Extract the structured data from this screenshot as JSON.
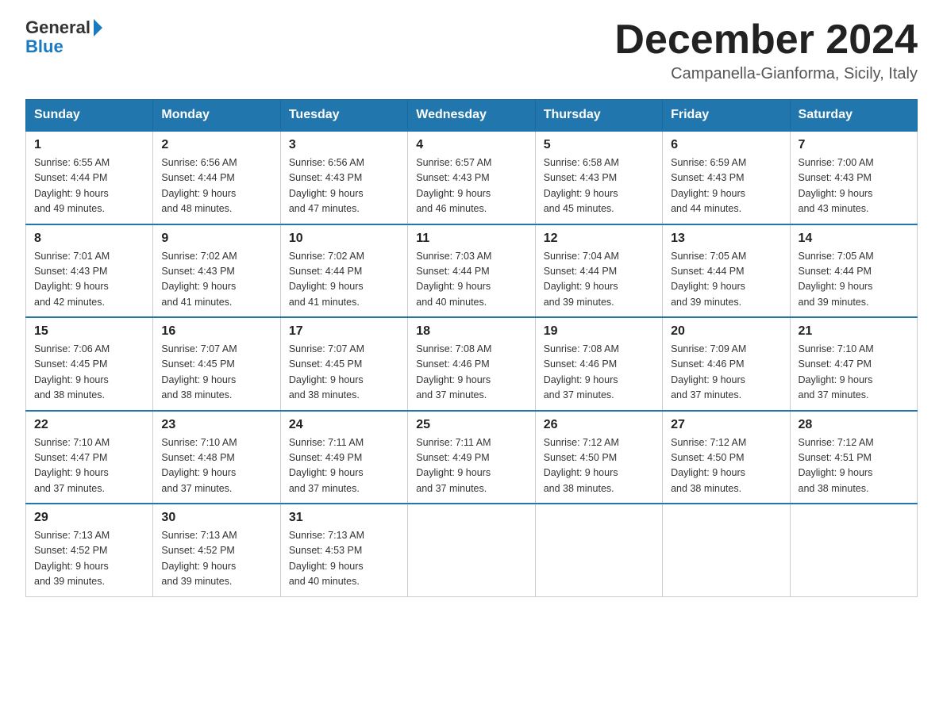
{
  "header": {
    "logo_general": "General",
    "logo_blue": "Blue",
    "month_title": "December 2024",
    "location": "Campanella-Gianforma, Sicily, Italy"
  },
  "days_of_week": [
    "Sunday",
    "Monday",
    "Tuesday",
    "Wednesday",
    "Thursday",
    "Friday",
    "Saturday"
  ],
  "weeks": [
    [
      {
        "day": "1",
        "sunrise": "6:55 AM",
        "sunset": "4:44 PM",
        "daylight": "9 hours and 49 minutes."
      },
      {
        "day": "2",
        "sunrise": "6:56 AM",
        "sunset": "4:44 PM",
        "daylight": "9 hours and 48 minutes."
      },
      {
        "day": "3",
        "sunrise": "6:56 AM",
        "sunset": "4:43 PM",
        "daylight": "9 hours and 47 minutes."
      },
      {
        "day": "4",
        "sunrise": "6:57 AM",
        "sunset": "4:43 PM",
        "daylight": "9 hours and 46 minutes."
      },
      {
        "day": "5",
        "sunrise": "6:58 AM",
        "sunset": "4:43 PM",
        "daylight": "9 hours and 45 minutes."
      },
      {
        "day": "6",
        "sunrise": "6:59 AM",
        "sunset": "4:43 PM",
        "daylight": "9 hours and 44 minutes."
      },
      {
        "day": "7",
        "sunrise": "7:00 AM",
        "sunset": "4:43 PM",
        "daylight": "9 hours and 43 minutes."
      }
    ],
    [
      {
        "day": "8",
        "sunrise": "7:01 AM",
        "sunset": "4:43 PM",
        "daylight": "9 hours and 42 minutes."
      },
      {
        "day": "9",
        "sunrise": "7:02 AM",
        "sunset": "4:43 PM",
        "daylight": "9 hours and 41 minutes."
      },
      {
        "day": "10",
        "sunrise": "7:02 AM",
        "sunset": "4:44 PM",
        "daylight": "9 hours and 41 minutes."
      },
      {
        "day": "11",
        "sunrise": "7:03 AM",
        "sunset": "4:44 PM",
        "daylight": "9 hours and 40 minutes."
      },
      {
        "day": "12",
        "sunrise": "7:04 AM",
        "sunset": "4:44 PM",
        "daylight": "9 hours and 39 minutes."
      },
      {
        "day": "13",
        "sunrise": "7:05 AM",
        "sunset": "4:44 PM",
        "daylight": "9 hours and 39 minutes."
      },
      {
        "day": "14",
        "sunrise": "7:05 AM",
        "sunset": "4:44 PM",
        "daylight": "9 hours and 39 minutes."
      }
    ],
    [
      {
        "day": "15",
        "sunrise": "7:06 AM",
        "sunset": "4:45 PM",
        "daylight": "9 hours and 38 minutes."
      },
      {
        "day": "16",
        "sunrise": "7:07 AM",
        "sunset": "4:45 PM",
        "daylight": "9 hours and 38 minutes."
      },
      {
        "day": "17",
        "sunrise": "7:07 AM",
        "sunset": "4:45 PM",
        "daylight": "9 hours and 38 minutes."
      },
      {
        "day": "18",
        "sunrise": "7:08 AM",
        "sunset": "4:46 PM",
        "daylight": "9 hours and 37 minutes."
      },
      {
        "day": "19",
        "sunrise": "7:08 AM",
        "sunset": "4:46 PM",
        "daylight": "9 hours and 37 minutes."
      },
      {
        "day": "20",
        "sunrise": "7:09 AM",
        "sunset": "4:46 PM",
        "daylight": "9 hours and 37 minutes."
      },
      {
        "day": "21",
        "sunrise": "7:10 AM",
        "sunset": "4:47 PM",
        "daylight": "9 hours and 37 minutes."
      }
    ],
    [
      {
        "day": "22",
        "sunrise": "7:10 AM",
        "sunset": "4:47 PM",
        "daylight": "9 hours and 37 minutes."
      },
      {
        "day": "23",
        "sunrise": "7:10 AM",
        "sunset": "4:48 PM",
        "daylight": "9 hours and 37 minutes."
      },
      {
        "day": "24",
        "sunrise": "7:11 AM",
        "sunset": "4:49 PM",
        "daylight": "9 hours and 37 minutes."
      },
      {
        "day": "25",
        "sunrise": "7:11 AM",
        "sunset": "4:49 PM",
        "daylight": "9 hours and 37 minutes."
      },
      {
        "day": "26",
        "sunrise": "7:12 AM",
        "sunset": "4:50 PM",
        "daylight": "9 hours and 38 minutes."
      },
      {
        "day": "27",
        "sunrise": "7:12 AM",
        "sunset": "4:50 PM",
        "daylight": "9 hours and 38 minutes."
      },
      {
        "day": "28",
        "sunrise": "7:12 AM",
        "sunset": "4:51 PM",
        "daylight": "9 hours and 38 minutes."
      }
    ],
    [
      {
        "day": "29",
        "sunrise": "7:13 AM",
        "sunset": "4:52 PM",
        "daylight": "9 hours and 39 minutes."
      },
      {
        "day": "30",
        "sunrise": "7:13 AM",
        "sunset": "4:52 PM",
        "daylight": "9 hours and 39 minutes."
      },
      {
        "day": "31",
        "sunrise": "7:13 AM",
        "sunset": "4:53 PM",
        "daylight": "9 hours and 40 minutes."
      },
      null,
      null,
      null,
      null
    ]
  ]
}
